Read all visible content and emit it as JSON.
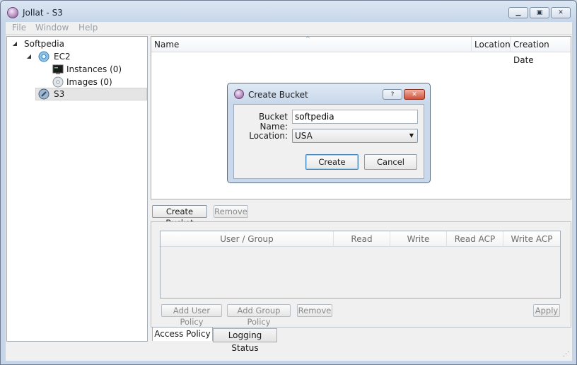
{
  "window": {
    "title": "Jollat - S3"
  },
  "menu": [
    {
      "label": "File"
    },
    {
      "label": "Window"
    },
    {
      "label": "Help"
    }
  ],
  "tree": {
    "root": {
      "label": "Softpedia"
    },
    "ec2": {
      "label": "EC2"
    },
    "instances": {
      "label": "Instances (0)"
    },
    "images": {
      "label": "Images (0)"
    },
    "s3": {
      "label": "S3"
    }
  },
  "bucket_list": {
    "columns": [
      "Name",
      "Location",
      "Creation Date"
    ]
  },
  "toolbar": {
    "create_bucket": "Create Bucket",
    "remove": "Remove"
  },
  "policy": {
    "columns": [
      "User / Group",
      "Read",
      "Write",
      "Read ACP",
      "Write ACP"
    ],
    "add_user_policy": "Add User Policy",
    "add_group_policy": "Add Group Policy",
    "remove": "Remove",
    "apply": "Apply"
  },
  "tabs": [
    {
      "label": "Access Policy",
      "active": true
    },
    {
      "label": "Logging Status",
      "active": false
    }
  ],
  "dialog": {
    "title": "Create Bucket",
    "help_glyph": "?",
    "bucket_name_label": "Bucket Name:",
    "bucket_name_value": "softpedia",
    "location_label": "Location:",
    "location_value": "USA",
    "create": "Create",
    "cancel": "Cancel"
  }
}
